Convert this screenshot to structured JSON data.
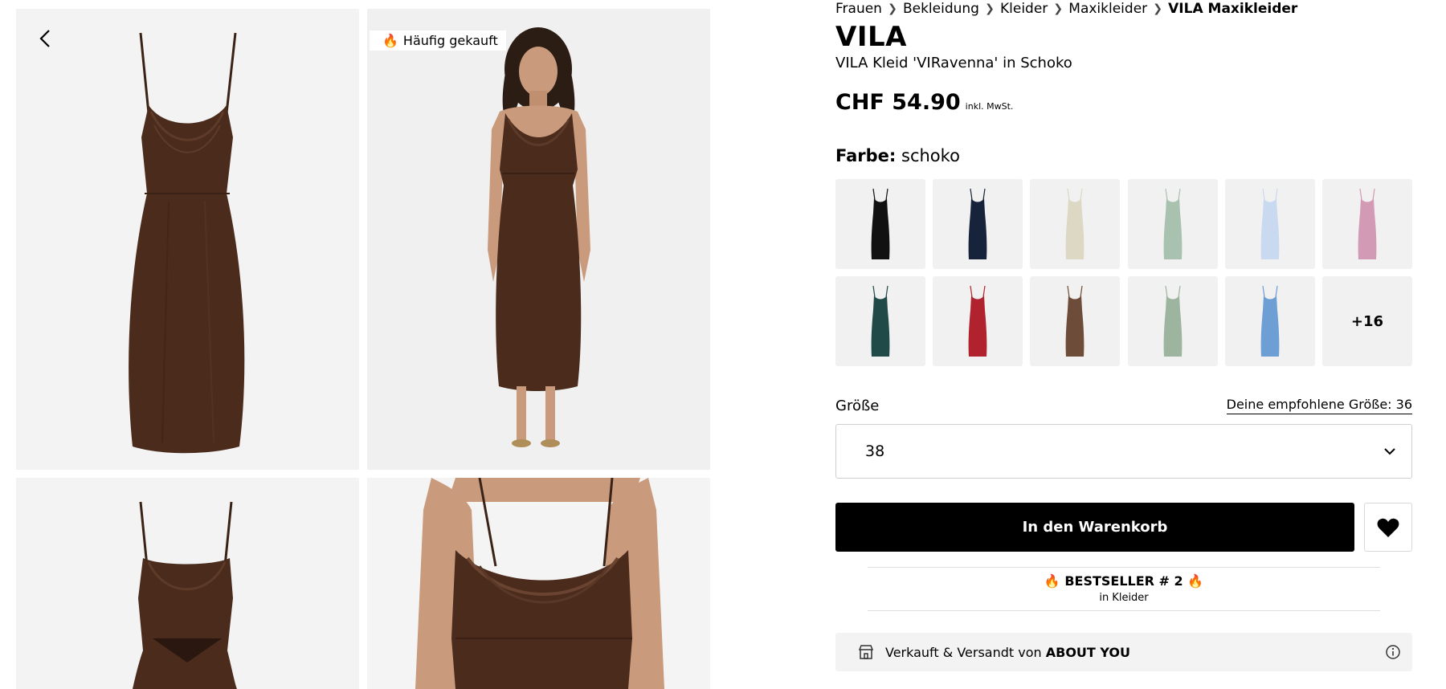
{
  "gallery": {
    "badge": "Häufig gekauft",
    "dress_color": "#4a2b1c"
  },
  "breadcrumb": [
    "Frauen",
    "Bekleidung",
    "Kleider",
    "Maxikleider",
    "VILA Maxikleider"
  ],
  "product": {
    "brand": "VILA",
    "name": "VILA Kleid 'VIRavenna' in Schoko",
    "price": "CHF 54.90",
    "vat_note": "inkl. MwSt."
  },
  "color": {
    "label": "Farbe:",
    "value": "schoko",
    "swatches": [
      "#111111",
      "#17233a",
      "#ddd8c4",
      "#a9c2b0",
      "#c9daf0",
      "#d39ab6",
      "#1f4a47",
      "#b0232e",
      "#6e4c3a",
      "#9db59f",
      "#6e9fd4"
    ],
    "more_label": "+16"
  },
  "size": {
    "label": "Größe",
    "recommended": "Deine empfohlene Größe: 36",
    "selected": "38"
  },
  "actions": {
    "cart_label": "In den Warenkorb"
  },
  "bestseller": {
    "title": "🔥 BESTSELLER # 2 🔥",
    "subtitle": "in Kleider"
  },
  "seller": {
    "prefix": "Verkauft & Versandt von ",
    "name": "ABOUT YOU"
  }
}
